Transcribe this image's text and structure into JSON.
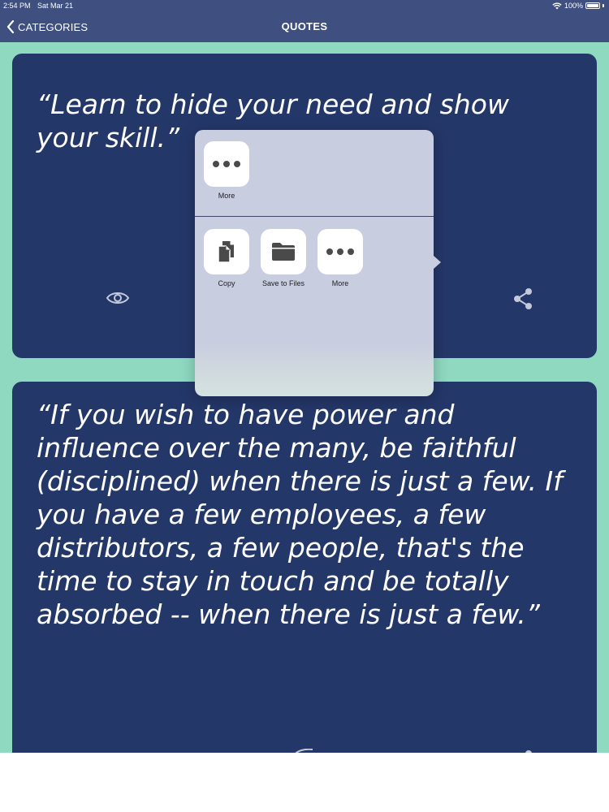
{
  "status_bar": {
    "time": "2:54 PM",
    "date": "Sat Mar 21",
    "battery": "100%"
  },
  "nav": {
    "back_label": "CATEGORIES",
    "title": "QUOTES"
  },
  "quotes": [
    {
      "text": "“Learn to hide your need and show your skill.”"
    },
    {
      "text": "“If you wish to have power and influence over the many, be faithful (disciplined) when there is just a few. If you have a few employees, a few distributors, a few people, that's the time to stay in touch and be totally absorbed -- when there is just a few.”"
    }
  ],
  "share_sheet": {
    "top_row": [
      {
        "label": "More",
        "icon": "more-icon"
      }
    ],
    "actions": [
      {
        "label": "Copy",
        "icon": "copy-icon"
      },
      {
        "label": "Save to Files",
        "icon": "folder-icon"
      },
      {
        "label": "More",
        "icon": "more-icon"
      }
    ]
  },
  "colors": {
    "nav": "#3e4f80",
    "card": "#243769",
    "background": "#8fd9c1",
    "sheet": "#c9cde0"
  }
}
